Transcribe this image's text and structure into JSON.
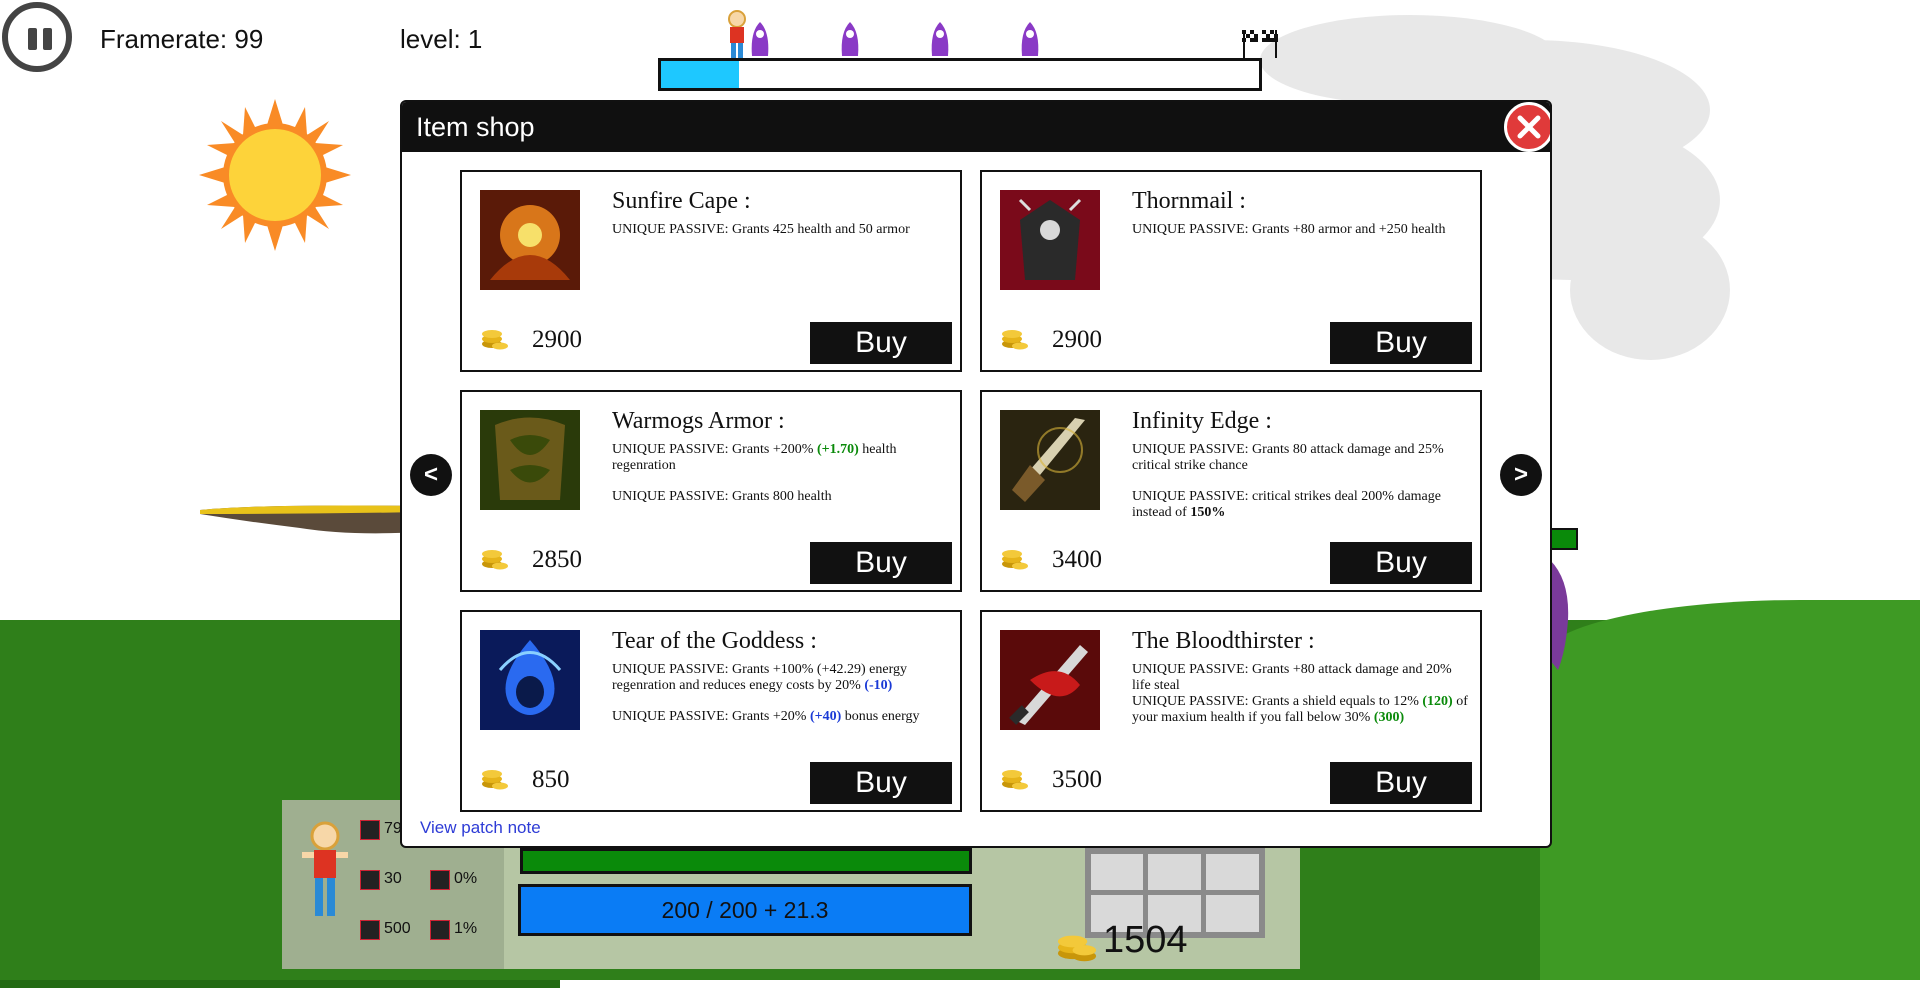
{
  "hud": {
    "framerate_label": "Framerate: 99",
    "level_label": "level: 1",
    "progress": 0.13
  },
  "shop": {
    "title": "Item shop",
    "prev_label": "<",
    "next_label": ">",
    "patch_link": "View patch note",
    "items": [
      {
        "name": "Sunfire Cape :",
        "desc1": "UNIQUE PASSIVE: Grants 425 health and 50 armor",
        "price": "2900",
        "buy": "Buy",
        "color": "#c0561a"
      },
      {
        "name": "Thornmail :",
        "desc1": "UNIQUE PASSIVE: Grants +80 armor and +250 health",
        "price": "2900",
        "buy": "Buy",
        "color": "#8a1a2a"
      },
      {
        "name": "Warmogs Armor :",
        "desc1a": "UNIQUE PASSIVE: Grants +200%",
        "desc1b": "(+1.70)",
        "desc1c": "health regenration",
        "desc2": "UNIQUE PASSIVE: Grants 800 health",
        "price": "2850",
        "buy": "Buy",
        "color": "#4d5a1a"
      },
      {
        "name": "Infinity Edge :",
        "desc1": "UNIQUE PASSIVE: Grants 80 attack damage and 25% critical strike chance",
        "desc2a": "UNIQUE PASSIVE: critical strikes deal 200% damage instead of",
        "desc2b": "150%",
        "price": "3400",
        "buy": "Buy",
        "color": "#6a5a20"
      },
      {
        "name": "Tear of the Goddess :",
        "desc1a": "UNIQUE PASSIVE: Grants +100% (+42.29) energy regenration and reduces enegy costs by 20%",
        "desc1b": "(-10)",
        "desc2a": "UNIQUE PASSIVE: Grants +20%",
        "desc2b": "(+40)",
        "desc2c": "bonus energy",
        "price": "850",
        "buy": "Buy",
        "color": "#1a3aa8"
      },
      {
        "name": "The Bloodthirster :",
        "desc1": "UNIQUE PASSIVE: Grants +80 attack damage and 20% life steal",
        "desc2a": "UNIQUE PASSIVE: Grants a shield equals to 12%",
        "desc2b": "(120)",
        "desc2c": "of your maxium health if you fall below 30%",
        "desc2d": "(300)",
        "price": "3500",
        "buy": "Buy",
        "color": "#a81a1a"
      }
    ]
  },
  "player": {
    "stats": [
      "79",
      "30",
      "0%",
      "500",
      "1%"
    ],
    "energy_text": "200 / 200 + 21.3",
    "gold": "1504"
  },
  "colors": {
    "accent_green": "#0a8a0a",
    "accent_blue": "#1a3ad6",
    "close_red": "#e03a3a",
    "progress_fill": "#1ec8ff"
  }
}
